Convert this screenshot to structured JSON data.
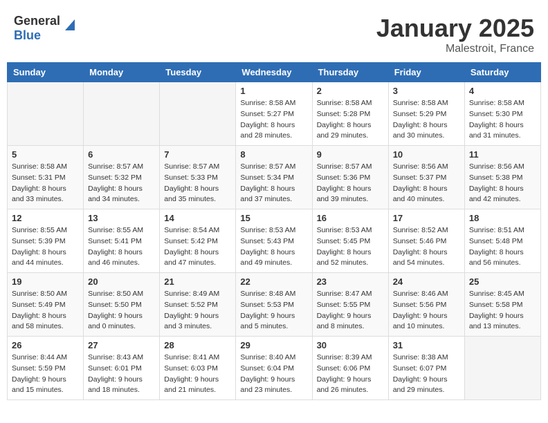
{
  "header": {
    "logo_general": "General",
    "logo_blue": "Blue",
    "month": "January 2025",
    "location": "Malestroit, France"
  },
  "days_of_week": [
    "Sunday",
    "Monday",
    "Tuesday",
    "Wednesday",
    "Thursday",
    "Friday",
    "Saturday"
  ],
  "weeks": [
    [
      {
        "day": "",
        "info": ""
      },
      {
        "day": "",
        "info": ""
      },
      {
        "day": "",
        "info": ""
      },
      {
        "day": "1",
        "info": "Sunrise: 8:58 AM\nSunset: 5:27 PM\nDaylight: 8 hours\nand 28 minutes."
      },
      {
        "day": "2",
        "info": "Sunrise: 8:58 AM\nSunset: 5:28 PM\nDaylight: 8 hours\nand 29 minutes."
      },
      {
        "day": "3",
        "info": "Sunrise: 8:58 AM\nSunset: 5:29 PM\nDaylight: 8 hours\nand 30 minutes."
      },
      {
        "day": "4",
        "info": "Sunrise: 8:58 AM\nSunset: 5:30 PM\nDaylight: 8 hours\nand 31 minutes."
      }
    ],
    [
      {
        "day": "5",
        "info": "Sunrise: 8:58 AM\nSunset: 5:31 PM\nDaylight: 8 hours\nand 33 minutes."
      },
      {
        "day": "6",
        "info": "Sunrise: 8:57 AM\nSunset: 5:32 PM\nDaylight: 8 hours\nand 34 minutes."
      },
      {
        "day": "7",
        "info": "Sunrise: 8:57 AM\nSunset: 5:33 PM\nDaylight: 8 hours\nand 35 minutes."
      },
      {
        "day": "8",
        "info": "Sunrise: 8:57 AM\nSunset: 5:34 PM\nDaylight: 8 hours\nand 37 minutes."
      },
      {
        "day": "9",
        "info": "Sunrise: 8:57 AM\nSunset: 5:36 PM\nDaylight: 8 hours\nand 39 minutes."
      },
      {
        "day": "10",
        "info": "Sunrise: 8:56 AM\nSunset: 5:37 PM\nDaylight: 8 hours\nand 40 minutes."
      },
      {
        "day": "11",
        "info": "Sunrise: 8:56 AM\nSunset: 5:38 PM\nDaylight: 8 hours\nand 42 minutes."
      }
    ],
    [
      {
        "day": "12",
        "info": "Sunrise: 8:55 AM\nSunset: 5:39 PM\nDaylight: 8 hours\nand 44 minutes."
      },
      {
        "day": "13",
        "info": "Sunrise: 8:55 AM\nSunset: 5:41 PM\nDaylight: 8 hours\nand 46 minutes."
      },
      {
        "day": "14",
        "info": "Sunrise: 8:54 AM\nSunset: 5:42 PM\nDaylight: 8 hours\nand 47 minutes."
      },
      {
        "day": "15",
        "info": "Sunrise: 8:53 AM\nSunset: 5:43 PM\nDaylight: 8 hours\nand 49 minutes."
      },
      {
        "day": "16",
        "info": "Sunrise: 8:53 AM\nSunset: 5:45 PM\nDaylight: 8 hours\nand 52 minutes."
      },
      {
        "day": "17",
        "info": "Sunrise: 8:52 AM\nSunset: 5:46 PM\nDaylight: 8 hours\nand 54 minutes."
      },
      {
        "day": "18",
        "info": "Sunrise: 8:51 AM\nSunset: 5:48 PM\nDaylight: 8 hours\nand 56 minutes."
      }
    ],
    [
      {
        "day": "19",
        "info": "Sunrise: 8:50 AM\nSunset: 5:49 PM\nDaylight: 8 hours\nand 58 minutes."
      },
      {
        "day": "20",
        "info": "Sunrise: 8:50 AM\nSunset: 5:50 PM\nDaylight: 9 hours\nand 0 minutes."
      },
      {
        "day": "21",
        "info": "Sunrise: 8:49 AM\nSunset: 5:52 PM\nDaylight: 9 hours\nand 3 minutes."
      },
      {
        "day": "22",
        "info": "Sunrise: 8:48 AM\nSunset: 5:53 PM\nDaylight: 9 hours\nand 5 minutes."
      },
      {
        "day": "23",
        "info": "Sunrise: 8:47 AM\nSunset: 5:55 PM\nDaylight: 9 hours\nand 8 minutes."
      },
      {
        "day": "24",
        "info": "Sunrise: 8:46 AM\nSunset: 5:56 PM\nDaylight: 9 hours\nand 10 minutes."
      },
      {
        "day": "25",
        "info": "Sunrise: 8:45 AM\nSunset: 5:58 PM\nDaylight: 9 hours\nand 13 minutes."
      }
    ],
    [
      {
        "day": "26",
        "info": "Sunrise: 8:44 AM\nSunset: 5:59 PM\nDaylight: 9 hours\nand 15 minutes."
      },
      {
        "day": "27",
        "info": "Sunrise: 8:43 AM\nSunset: 6:01 PM\nDaylight: 9 hours\nand 18 minutes."
      },
      {
        "day": "28",
        "info": "Sunrise: 8:41 AM\nSunset: 6:03 PM\nDaylight: 9 hours\nand 21 minutes."
      },
      {
        "day": "29",
        "info": "Sunrise: 8:40 AM\nSunset: 6:04 PM\nDaylight: 9 hours\nand 23 minutes."
      },
      {
        "day": "30",
        "info": "Sunrise: 8:39 AM\nSunset: 6:06 PM\nDaylight: 9 hours\nand 26 minutes."
      },
      {
        "day": "31",
        "info": "Sunrise: 8:38 AM\nSunset: 6:07 PM\nDaylight: 9 hours\nand 29 minutes."
      },
      {
        "day": "",
        "info": ""
      }
    ]
  ]
}
